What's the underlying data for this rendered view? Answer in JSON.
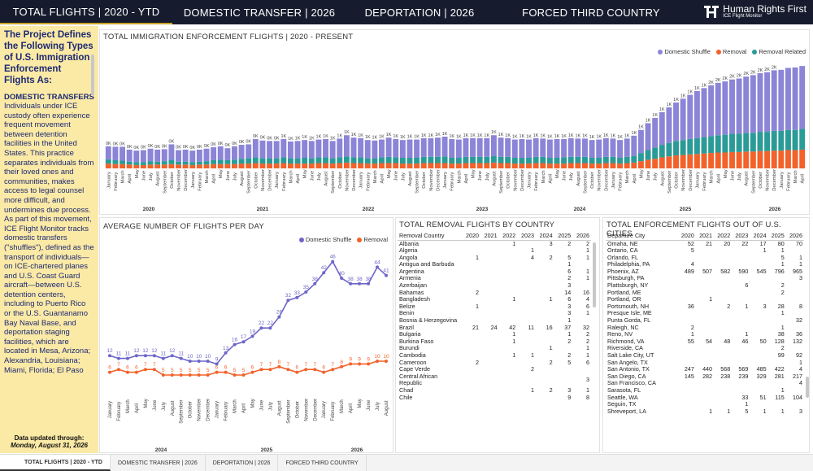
{
  "nav": {
    "tabs": [
      "TOTAL FLIGHTS | 2020 - YTD",
      "DOMESTIC TRANSFER | 2026",
      "DEPORTATION | 2026",
      "FORCED THIRD COUNTRY"
    ],
    "brand_name": "Human Rights First",
    "brand_sub": "ICE Flight Monitor"
  },
  "sidebar": {
    "heading": "The Project Defines the Following Types of U.S. Immigration Enforcement Flights As:",
    "section": "DOMESTIC TRANSFERS",
    "body": "Individuals under ICE custody often experience frequent movement between detention facilities in the United States. This practice separates individuals from their loved ones and communities, makes access to legal counsel more difficult, and undermines due process. As part of this movement, ICE Flight Monitor tracks domestic transfers (\"shuffles\"), defined as the transport of individuals—on ICE-chartered planes and U.S. Coast Guard aircraft—between U.S. detention centers, including to Puerto Rico or the U.S. Guantanamo Bay Naval Base, and deportation staging facilities, which are located in Mesa, Arizona; Alexandria, Louisiana; Miami, Florida; El Paso",
    "updated_label": "Data updated through:",
    "updated_date": "Monday, August 31, 2026"
  },
  "colors": {
    "shuffle": "#8b84d7",
    "removal": "#f2622a",
    "related": "#2a9b96",
    "nav_bg": "#161c2e",
    "sidebar_bg": "#fbe9a6",
    "sidebar_text": "#1c2a73"
  },
  "bottom_tabs": [
    "TOTAL FLIGHTS | 2020 - YTD",
    "DOMESTIC TRANSFER | 2026",
    "DEPORTATION | 2026",
    "FORCED THIRD COUNTRY"
  ],
  "main_chart": {
    "title": "TOTAL IMMIGRATION ENFORCEMENT FLIGHTS | 2020 - PRESENT",
    "legend": [
      "Domestic Shuffle",
      "Removal",
      "Removal Related"
    ]
  },
  "avg_chart": {
    "title": "AVERAGE NUMBER OF FLIGHTS PER DAY",
    "legend": [
      "Domestic Shuffle",
      "Removal"
    ]
  },
  "country_table": {
    "title": "TOTAL REMOVAL FLIGHTS BY COUNTRY",
    "headers": [
      "Removal Country",
      "2020",
      "2021",
      "2022",
      "2023",
      "2024",
      "2025",
      "2026"
    ],
    "rows": [
      [
        "Albania",
        "",
        "",
        "1",
        "",
        "3",
        "2",
        "2"
      ],
      [
        "Algeria",
        "",
        "",
        "",
        "1",
        "",
        "",
        "1"
      ],
      [
        "Angola",
        "1",
        "",
        "",
        "4",
        "2",
        "5",
        "1"
      ],
      [
        "Antigua and Barbuda",
        "",
        "",
        "",
        "",
        "",
        "1",
        ""
      ],
      [
        "Argentina",
        "",
        "",
        "",
        "",
        "",
        "6",
        "1"
      ],
      [
        "Armenia",
        "",
        "",
        "",
        "",
        "",
        "2",
        "1"
      ],
      [
        "Azerbaijan",
        "",
        "",
        "",
        "",
        "",
        "3",
        ""
      ],
      [
        "Bahamas",
        "2",
        "",
        "",
        "",
        "",
        "14",
        "16"
      ],
      [
        "Bangladesh",
        "",
        "",
        "1",
        "",
        "1",
        "6",
        "4"
      ],
      [
        "Belize",
        "1",
        "",
        "",
        "",
        "",
        "3",
        "6"
      ],
      [
        "Benin",
        "",
        "",
        "",
        "",
        "",
        "3",
        "1"
      ],
      [
        "Bosnia & Herzegovina",
        "",
        "",
        "",
        "",
        "",
        "1",
        ""
      ],
      [
        "Brazil",
        "21",
        "24",
        "42",
        "11",
        "16",
        "37",
        "32"
      ],
      [
        "Bulgaria",
        "",
        "",
        "1",
        "",
        "",
        "1",
        "2"
      ],
      [
        "Burkina Faso",
        "",
        "",
        "1",
        "",
        "",
        "2",
        "2"
      ],
      [
        "Burundi",
        "",
        "",
        "",
        "",
        "1",
        "",
        "1"
      ],
      [
        "Cambodia",
        "",
        "",
        "1",
        "1",
        "",
        "2",
        "1"
      ],
      [
        "Cameroon",
        "2",
        "",
        "",
        "",
        "2",
        "5",
        "6"
      ],
      [
        "Cape Verde",
        "",
        "",
        "",
        "2",
        "",
        "",
        ""
      ],
      [
        "Central African Republic",
        "",
        "",
        "",
        "",
        "",
        "",
        "3"
      ],
      [
        "Chad",
        "",
        "",
        "",
        "1",
        "2",
        "3",
        "1"
      ],
      [
        "Chile",
        "",
        "",
        "",
        "",
        "",
        "9",
        "8"
      ]
    ]
  },
  "city_table": {
    "title": "TOTAL ENFORCEMENT FLIGHTS OUT OF U.S. CITIES",
    "headers": [
      "Departure City",
      "2020",
      "2021",
      "2022",
      "2023",
      "2024",
      "2025",
      "2026"
    ],
    "rows": [
      [
        "Omaha, NE",
        "52",
        "21",
        "20",
        "22",
        "17",
        "80",
        "70"
      ],
      [
        "Ontario, CA",
        "5",
        "",
        "",
        "",
        "1",
        "1",
        ""
      ],
      [
        "Orlando, FL",
        "",
        "",
        "",
        "",
        "",
        "5",
        "1"
      ],
      [
        "Philadelphia, PA",
        "4",
        "",
        "",
        "",
        "",
        "1",
        "1"
      ],
      [
        "Phoenix, AZ",
        "489",
        "507",
        "582",
        "590",
        "545",
        "796",
        "965"
      ],
      [
        "Pittsburgh, PA",
        "",
        "",
        "",
        "",
        "",
        "",
        "3"
      ],
      [
        "Plattsburgh, NY",
        "",
        "",
        "",
        "6",
        "",
        "2",
        ""
      ],
      [
        "Portland, ME",
        "",
        "",
        "",
        "",
        "",
        "2",
        ""
      ],
      [
        "Portland, OR",
        "",
        "1",
        "",
        "",
        "",
        "",
        ""
      ],
      [
        "Portsmouth, NH",
        "36",
        "",
        "2",
        "1",
        "3",
        "28",
        "8"
      ],
      [
        "Presque Isle, ME",
        "",
        "",
        "",
        "",
        "",
        "1",
        ""
      ],
      [
        "Punta Gorda, FL",
        "",
        "",
        "",
        "",
        "",
        "",
        "32"
      ],
      [
        "Raleigh, NC",
        "2",
        "",
        "",
        "",
        "",
        "1",
        ""
      ],
      [
        "Reno, NV",
        "1",
        "",
        "",
        "1",
        "",
        "38",
        "36"
      ],
      [
        "Richmond, VA",
        "55",
        "54",
        "48",
        "46",
        "50",
        "128",
        "132"
      ],
      [
        "Riverside, CA",
        "",
        "",
        "",
        "",
        "",
        "2",
        ""
      ],
      [
        "Salt Lake City, UT",
        "",
        "",
        "",
        "",
        "",
        "99",
        "92"
      ],
      [
        "San Angelo, TX",
        "",
        "",
        "",
        "",
        "",
        "",
        "1"
      ],
      [
        "San Antonio, TX",
        "247",
        "440",
        "568",
        "569",
        "485",
        "422",
        "4"
      ],
      [
        "San Diego, CA",
        "145",
        "282",
        "238",
        "239",
        "329",
        "281",
        "217"
      ],
      [
        "San Francisco, CA",
        "",
        "",
        "",
        "",
        "",
        "",
        "4"
      ],
      [
        "Sarasota, FL",
        "",
        "",
        "",
        "",
        "",
        "1",
        ""
      ],
      [
        "Seattle, WA",
        "",
        "",
        "",
        "33",
        "51",
        "115",
        "104"
      ],
      [
        "Seguin, TX",
        "",
        "",
        "",
        "1",
        "",
        "",
        ""
      ],
      [
        "Shreveport, LA",
        "",
        "1",
        "1",
        "5",
        "1",
        "1",
        "3"
      ]
    ]
  },
  "chart_data": [
    {
      "type": "bar",
      "title": "TOTAL IMMIGRATION ENFORCEMENT FLIGHTS | 2020 - PRESENT",
      "stacked": true,
      "year_labels": [
        "2020",
        "2021",
        "2022",
        "2023",
        "2024",
        "2025",
        "2026"
      ],
      "month_labels": [
        "January",
        "February",
        "March",
        "April",
        "May",
        "June",
        "July",
        "August",
        "September",
        "October",
        "November",
        "December"
      ],
      "data_labels": [
        "0K",
        "0K",
        "0K",
        "0K",
        "0K",
        "0K",
        "0K",
        "0K",
        "0K",
        "0K",
        "0K",
        "0K",
        "0K",
        "0K",
        "0K",
        "0K",
        "0K",
        "0K",
        "0K",
        "0K",
        "0K",
        "0K",
        "0K",
        "0K",
        "0K",
        "1K",
        "1K",
        "1K",
        "1K",
        "1K",
        "1K",
        "1K",
        "1K",
        "1K",
        "1K",
        "1K",
        "1K",
        "1K",
        "1K",
        "1K",
        "1K",
        "1K",
        "1K",
        "1K",
        "1K",
        "1K",
        "1K",
        "1K",
        "1K",
        "1K",
        "1K",
        "1K",
        "1K",
        "1K",
        "1K",
        "1K",
        "1K",
        "1K",
        "1K",
        "1K",
        "1K",
        "1K",
        "1K",
        "1K",
        "1K",
        "1K",
        "1K",
        "1K",
        "1K",
        "1K",
        "1K",
        "1K",
        "1K",
        "1K",
        "1K",
        "1K",
        "1K",
        "1K",
        "1K",
        "1K",
        "1K",
        "1K",
        "1K",
        "1K",
        "1K",
        "1K",
        "2K",
        "2K",
        "2K",
        "2K",
        "2K",
        "2K",
        "2K",
        "2K",
        "2K",
        "2K"
      ],
      "series": [
        {
          "name": "Domestic Shuffle",
          "values": [
            270,
            280,
            290,
            250,
            240,
            250,
            260,
            250,
            250,
            320,
            240,
            250,
            240,
            250,
            260,
            270,
            280,
            250,
            280,
            290,
            290,
            380,
            370,
            360,
            360,
            380,
            350,
            360,
            370,
            360,
            370,
            380,
            360,
            390,
            440,
            410,
            400,
            380,
            370,
            370,
            400,
            380,
            370,
            380,
            380,
            390,
            390,
            400,
            410,
            390,
            380,
            390,
            390,
            390,
            390,
            430,
            400,
            390,
            380,
            390,
            380,
            390,
            380,
            380,
            390,
            380,
            390,
            380,
            380,
            370,
            380,
            390,
            380,
            370,
            380,
            420,
            480,
            560,
            620,
            680,
            740,
            800,
            860,
            920,
            980,
            1020,
            1060,
            1090,
            1110,
            1130,
            1150,
            1170,
            1200,
            1220,
            1240,
            1260,
            1270,
            1290,
            1300,
            1310
          ]
        },
        {
          "name": "Removal",
          "values": [
            100,
            90,
            90,
            80,
            70,
            70,
            80,
            80,
            80,
            90,
            80,
            80,
            70,
            80,
            80,
            90,
            90,
            90,
            90,
            100,
            100,
            110,
            100,
            100,
            100,
            110,
            100,
            100,
            100,
            100,
            110,
            110,
            100,
            110,
            120,
            110,
            110,
            100,
            100,
            110,
            110,
            110,
            100,
            100,
            100,
            110,
            110,
            110,
            110,
            100,
            100,
            110,
            110,
            110,
            110,
            120,
            110,
            110,
            100,
            100,
            100,
            110,
            110,
            100,
            100,
            100,
            110,
            110,
            110,
            100,
            100,
            110,
            110,
            100,
            110,
            120,
            150,
            180,
            200,
            230,
            250,
            270,
            280,
            290,
            300,
            310,
            320,
            330,
            330,
            340,
            340,
            350,
            350,
            360,
            360,
            370,
            370,
            380,
            380,
            390
          ]
        },
        {
          "name": "Removal Related",
          "values": [
            90,
            80,
            70,
            60,
            60,
            60,
            70,
            60,
            70,
            90,
            60,
            60,
            60,
            60,
            70,
            80,
            90,
            80,
            90,
            100,
            110,
            120,
            110,
            110,
            110,
            120,
            110,
            110,
            120,
            110,
            120,
            120,
            110,
            120,
            130,
            120,
            120,
            110,
            110,
            120,
            130,
            120,
            120,
            120,
            120,
            130,
            130,
            130,
            140,
            120,
            120,
            130,
            130,
            130,
            130,
            140,
            130,
            130,
            120,
            120,
            120,
            130,
            130,
            120,
            120,
            130,
            130,
            130,
            130,
            120,
            120,
            130,
            130,
            120,
            130,
            140,
            170,
            200,
            230,
            260,
            280,
            300,
            310,
            320,
            330,
            340,
            350,
            360,
            370,
            380,
            380,
            390,
            390,
            400,
            400,
            410,
            410,
            420,
            420,
            430
          ]
        }
      ]
    },
    {
      "type": "line",
      "title": "AVERAGE NUMBER OF FLIGHTS PER DAY",
      "x": [
        "January",
        "February",
        "March",
        "April",
        "May",
        "June",
        "July",
        "August",
        "September",
        "October",
        "November",
        "December",
        "January",
        "February",
        "March",
        "April",
        "May",
        "June",
        "July",
        "August",
        "September",
        "October",
        "November",
        "December",
        "January",
        "February",
        "March",
        "April",
        "May",
        "June",
        "July",
        "August"
      ],
      "year_labels": [
        "2024",
        "2025",
        "2026"
      ],
      "series": [
        {
          "name": "Domestic Shuffle",
          "values": [
            12,
            11,
            11,
            12,
            12,
            12,
            11,
            12,
            11,
            10,
            10,
            10,
            9,
            13,
            16,
            17,
            19,
            22,
            22,
            26,
            32,
            33,
            35,
            38,
            42,
            46,
            40,
            38,
            38,
            38,
            44,
            41
          ]
        },
        {
          "name": "Removal",
          "values": [
            6,
            7,
            6,
            6,
            7,
            7,
            5,
            5,
            5,
            5,
            5,
            5,
            6,
            6,
            5,
            5,
            6,
            7,
            7,
            8,
            7,
            6,
            7,
            7,
            6,
            7,
            8,
            9,
            9,
            9,
            10,
            10
          ]
        }
      ]
    }
  ]
}
